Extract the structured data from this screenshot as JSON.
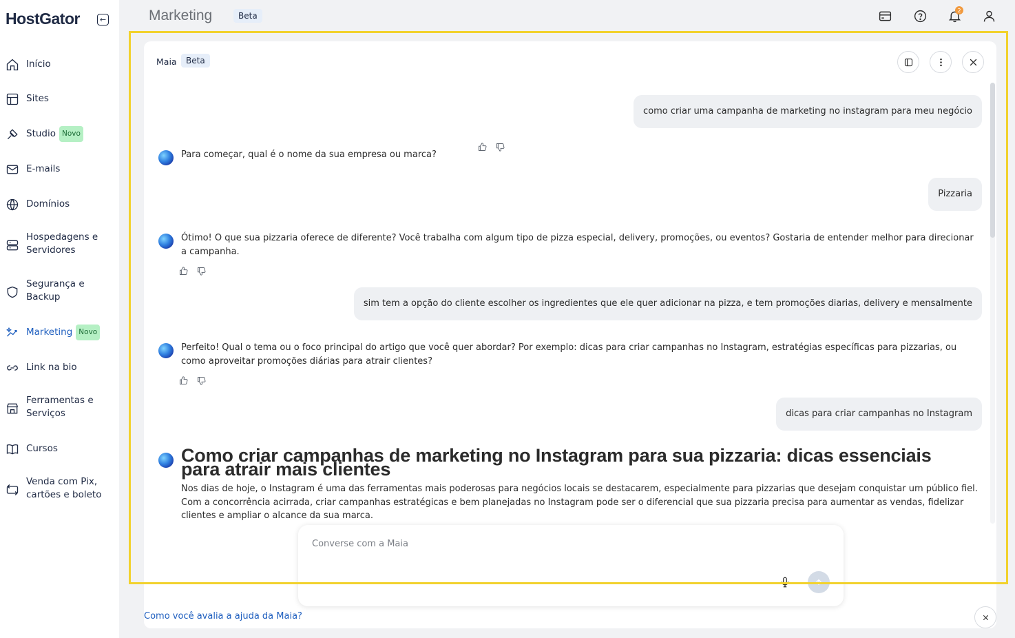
{
  "app": {
    "brand": "HostGator",
    "page_title": "Marketing",
    "page_badge": "Beta"
  },
  "sidebar": {
    "items": [
      {
        "label": "Início",
        "icon": "home-icon"
      },
      {
        "label": "Sites",
        "icon": "layout-icon"
      },
      {
        "label": "Studio",
        "icon": "studio-icon",
        "badge": "Novo"
      },
      {
        "label": "E-mails",
        "icon": "mail-icon"
      },
      {
        "label": "Domínios",
        "icon": "globe-icon"
      },
      {
        "label": "Hospedagens e\nServidores",
        "icon": "server-icon"
      },
      {
        "label": "Segurança e\nBackup",
        "icon": "shield-icon"
      },
      {
        "label": "Marketing",
        "icon": "sparkle-icon",
        "badge": "Novo",
        "active": true
      },
      {
        "label": "Link na bio",
        "icon": "link-icon"
      },
      {
        "label": "Ferramentas e\nServiços",
        "icon": "store-icon"
      },
      {
        "label": "Cursos",
        "icon": "book-icon"
      },
      {
        "label": "Venda com Pix,\ncartões e boleto",
        "icon": "payment-icon"
      }
    ]
  },
  "header": {
    "notification_count": "2"
  },
  "chat": {
    "title": "Maia",
    "badge": "Beta",
    "messages": [
      {
        "role": "user",
        "text": "como criar uma campanha de marketing no instagram para meu negócio"
      },
      {
        "role": "bot",
        "text": "Para começar, qual é o nome da sua empresa ou marca?"
      },
      {
        "role": "user",
        "text": "Pizzaria"
      },
      {
        "role": "bot",
        "text": "Ótimo! O que sua pizzaria oferece de diferente? Você trabalha com algum tipo de pizza especial, delivery, promoções, ou eventos? Gostaria de entender melhor para direcionar a campanha."
      },
      {
        "role": "user",
        "text": "sim tem a opção do cliente escolher os ingredientes que ele quer adicionar na pizza, e tem promoções diarias, delivery e mensalmente"
      },
      {
        "role": "bot",
        "text": "Perfeito! Qual o tema ou o foco principal do artigo que você quer abordar? Por exemplo: dicas para criar campanhas no Instagram, estratégias específicas para pizzarias, ou como aproveitar promoções diárias para atrair clientes?"
      },
      {
        "role": "user",
        "text": "dicas para criar campanhas no Instagram"
      }
    ],
    "article": {
      "title": "Como criar campanhas de marketing no Instagram para sua pizzaria: dicas essenciais para atrair mais clientes",
      "body": "Nos dias de hoje, o Instagram é uma das ferramentas mais poderosas para negócios locais se destacarem, especialmente para pizzarias que desejam conquistar um público fiel. Com a concorrência acirrada, criar campanhas estratégicas e bem planejadas no Instagram pode ser o diferencial que sua pizzaria precisa para aumentar as vendas, fidelizar clientes e ampliar o alcance da sua marca."
    },
    "composer": {
      "placeholder": "Converse com a Maia",
      "value": ""
    },
    "rating_prompt": "Como você avalia a ajuda da Maia?"
  },
  "colors": {
    "accent": "#1f5fbf",
    "novo_badge_bg": "#b5f0c4",
    "highlight_frame": "#f2d22e",
    "notification": "#f19a3e"
  }
}
